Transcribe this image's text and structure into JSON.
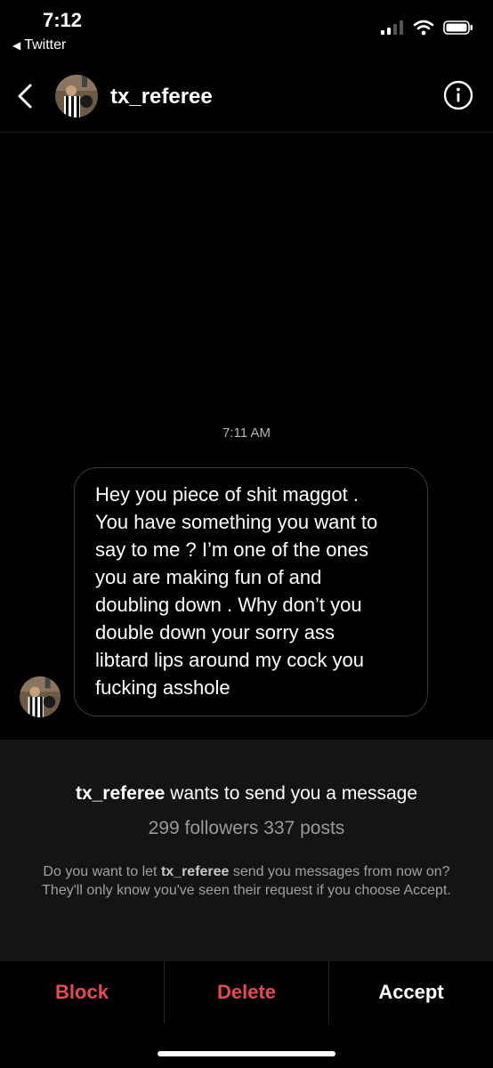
{
  "status_bar": {
    "time": "7:12",
    "back_app": "Twitter"
  },
  "header": {
    "username": "tx_referee"
  },
  "conversation": {
    "timestamp": "7:11 AM",
    "message_lines": [
      "Hey you piece of shit maggot .",
      "You have something you want to",
      "say to me ? I’m one of the ones",
      "you are making fun of and",
      "doubling down . Why don’t you",
      "double down your sorry ass",
      "libtard lips around my cock you",
      "fucking asshole"
    ]
  },
  "request": {
    "username": "tx_referee",
    "title_suffix": " wants to send you a message",
    "stats": "299 followers 337 posts",
    "body_prefix": "Do you want to let ",
    "body_suffix": " send you messages from now on? They'll only know you've seen their request if you choose Accept."
  },
  "actions": {
    "block": "Block",
    "delete": "Delete",
    "accept": "Accept"
  },
  "colors": {
    "destructive": "#e14c55",
    "panel": "#141414",
    "background": "#000000"
  }
}
